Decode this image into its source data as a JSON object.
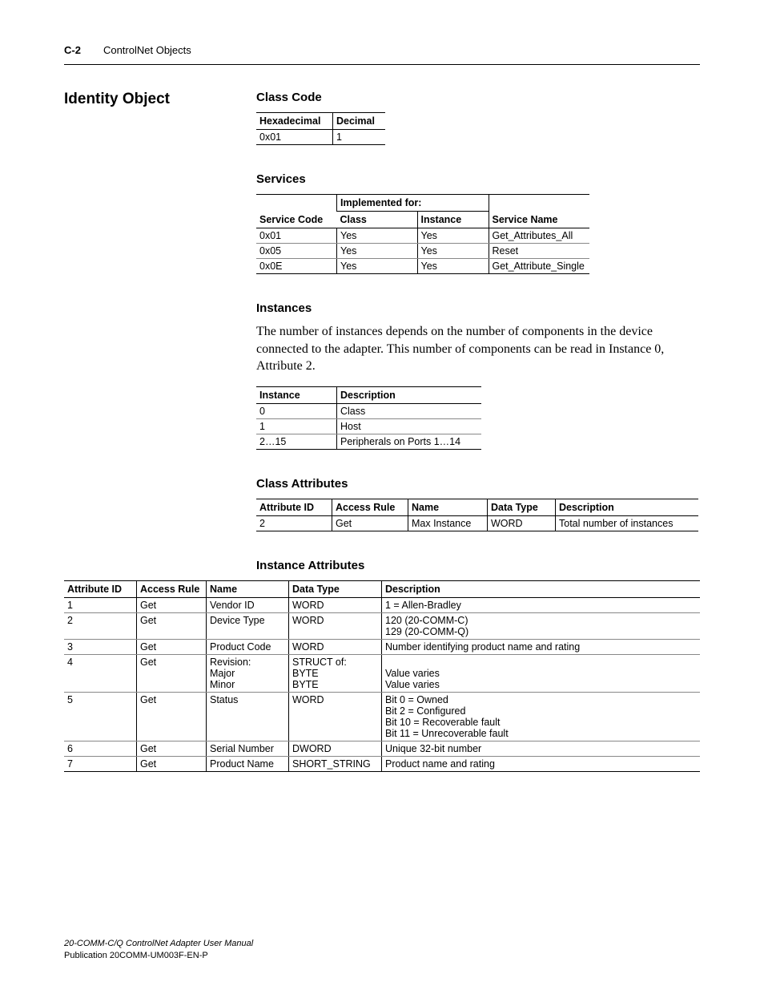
{
  "header": {
    "pagenum": "C-2",
    "chapter": "ControlNet Objects"
  },
  "left_heading": "Identity Object",
  "sections": {
    "classcode": {
      "title": "Class Code",
      "headers": [
        "Hexadecimal",
        "Decimal"
      ],
      "rows": [
        [
          "0x01",
          "1"
        ]
      ]
    },
    "services": {
      "title": "Services",
      "group": "Implemented for:",
      "headers": [
        "Service Code",
        "Class",
        "Instance",
        "Service Name"
      ],
      "rows": [
        [
          "0x01",
          "Yes",
          "Yes",
          "Get_Attributes_All"
        ],
        [
          "0x05",
          "Yes",
          "Yes",
          "Reset"
        ],
        [
          "0x0E",
          "Yes",
          "Yes",
          "Get_Attribute_Single"
        ]
      ]
    },
    "instances": {
      "title": "Instances",
      "body": "The number of instances depends on the number of components in the device connected to the adapter. This number of components can be read in Instance 0, Attribute 2.",
      "headers": [
        "Instance",
        "Description"
      ],
      "rows": [
        [
          "0",
          "Class"
        ],
        [
          "1",
          "Host"
        ],
        [
          "2…15",
          "Peripherals on Ports 1…14"
        ]
      ]
    },
    "classattr": {
      "title": "Class Attributes",
      "headers": [
        "Attribute ID",
        "Access Rule",
        "Name",
        "Data Type",
        "Description"
      ],
      "rows": [
        [
          "2",
          "Get",
          "Max Instance",
          "WORD",
          "Total number of instances"
        ]
      ]
    },
    "instattr": {
      "title": "Instance Attributes",
      "headers": [
        "Attribute ID",
        "Access Rule",
        "Name",
        "Data Type",
        "Description"
      ],
      "rows": [
        {
          "c": [
            "1",
            "Get",
            "Vendor ID",
            "WORD",
            "1 = Allen-Bradley"
          ]
        },
        {
          "c": [
            "2",
            "Get",
            "Device Type",
            "WORD",
            "120 (20-COMM-C)\n129 (20-COMM-Q)"
          ]
        },
        {
          "c": [
            "3",
            "Get",
            "Product Code",
            "WORD",
            "Number identifying product name and rating"
          ]
        },
        {
          "c": [
            "4",
            "Get",
            "Revision:\n    Major\n    Minor",
            "STRUCT of:\n    BYTE\n    BYTE",
            "\nValue varies\nValue varies"
          ]
        },
        {
          "c": [
            "5",
            "Get",
            "Status",
            "WORD",
            "Bit 0 = Owned\nBit 2 = Configured\nBit 10 = Recoverable fault\nBit 11 = Unrecoverable fault"
          ]
        },
        {
          "c": [
            "6",
            "Get",
            "Serial Number",
            "DWORD",
            "Unique 32-bit number"
          ]
        },
        {
          "c": [
            "7",
            "Get",
            "Product Name",
            "SHORT_STRING",
            "Product name and rating"
          ]
        }
      ]
    }
  },
  "footer": {
    "line1": "20-COMM-C/Q ControlNet Adapter User Manual",
    "line2": "Publication 20COMM-UM003F-EN-P"
  }
}
